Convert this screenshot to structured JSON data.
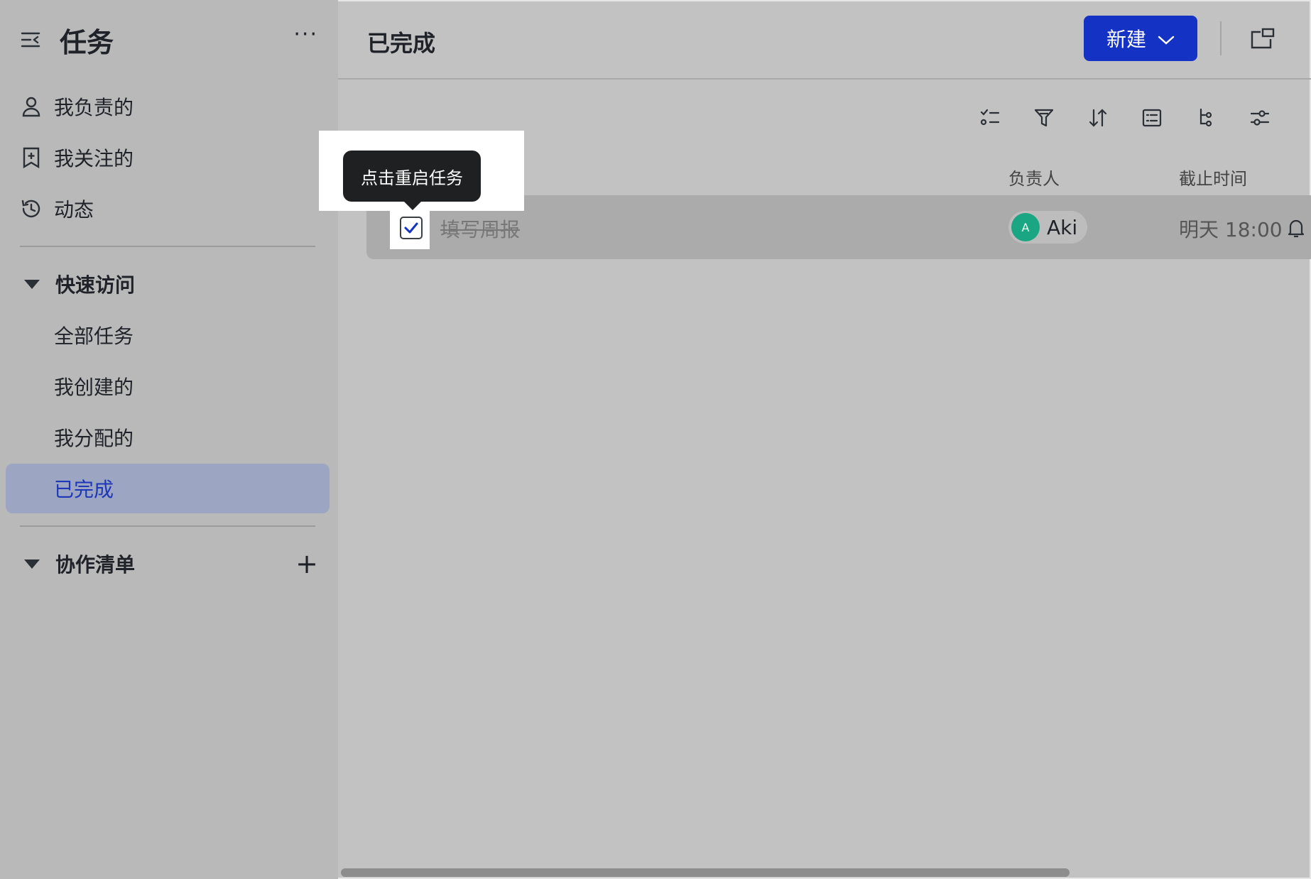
{
  "sidebar": {
    "title": "任务",
    "more": "···",
    "items": [
      {
        "label": "我负责的",
        "icon": "user-icon"
      },
      {
        "label": "我关注的",
        "icon": "bookmark-plus-icon"
      },
      {
        "label": "动态",
        "icon": "history-icon"
      }
    ],
    "quick_access": {
      "label": "快速访问",
      "items": [
        "全部任务",
        "我创建的",
        "我分配的",
        "已完成"
      ],
      "active": "已完成"
    },
    "collab": {
      "label": "协作清单",
      "add": "+"
    }
  },
  "header": {
    "title": "已完成",
    "new_button": "新建"
  },
  "table": {
    "columns": {
      "assignee": "负责人",
      "due": "截止时间"
    },
    "rows": [
      {
        "name": "填写周报",
        "assignee_initial": "A",
        "assignee": "Aki",
        "due": "明天 18:00",
        "completed": true
      }
    ]
  },
  "tooltip": "点击重启任务",
  "colors": {
    "accent": "#1432c4",
    "active_bg": "#9ca5c2",
    "avatar": "#1aa583"
  }
}
